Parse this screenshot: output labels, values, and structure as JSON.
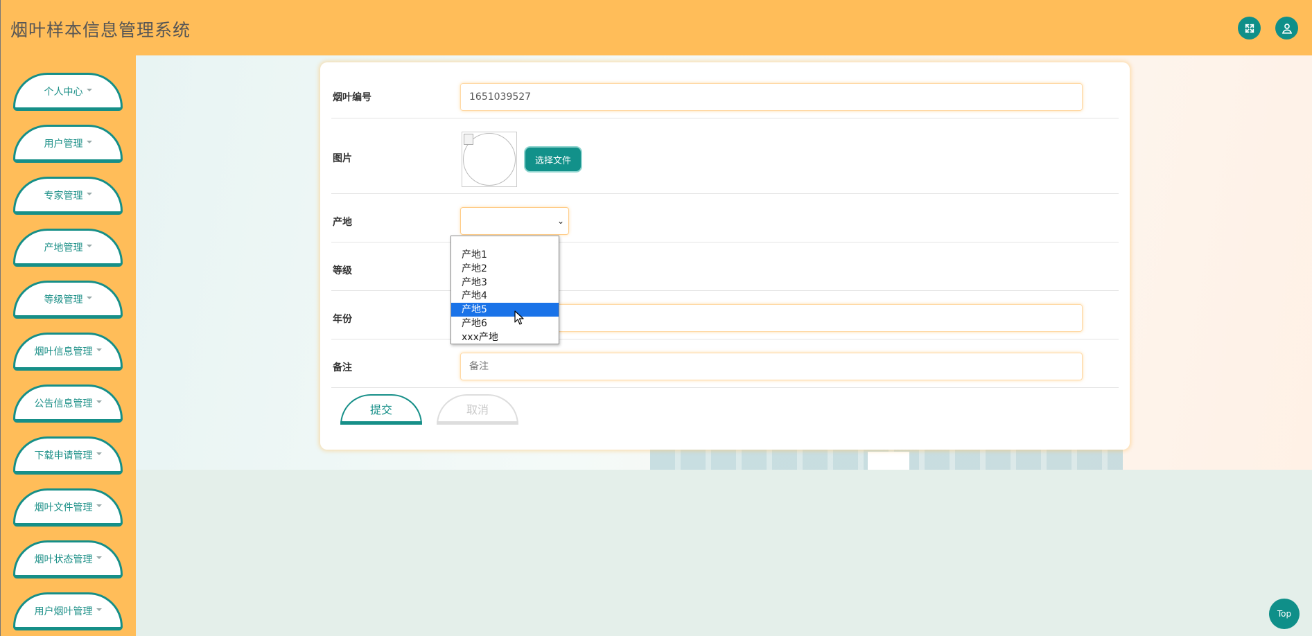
{
  "app": {
    "title": "烟叶样本信息管理系统"
  },
  "header": {
    "fullscreen_icon": "expand-arrows-icon",
    "user_icon": "user-icon"
  },
  "sidebar": {
    "items": [
      {
        "label": "个人中心"
      },
      {
        "label": "用户管理"
      },
      {
        "label": "专家管理"
      },
      {
        "label": "产地管理"
      },
      {
        "label": "等级管理"
      },
      {
        "label": "烟叶信息管理"
      },
      {
        "label": "公告信息管理"
      },
      {
        "label": "下载申请管理"
      },
      {
        "label": "烟叶文件管理"
      },
      {
        "label": "烟叶状态管理"
      },
      {
        "label": "用户烟叶管理"
      }
    ]
  },
  "form": {
    "code": {
      "label": "烟叶编号",
      "value": "1651039527"
    },
    "image": {
      "label": "图片",
      "button": "选择文件"
    },
    "origin": {
      "label": "产地",
      "value": "",
      "options": [
        "",
        "产地1",
        "产地2",
        "产地3",
        "产地4",
        "产地5",
        "产地6",
        "xxx产地"
      ],
      "highlighted": "产地5"
    },
    "grade": {
      "label": "等级"
    },
    "year": {
      "label": "年份",
      "value": ""
    },
    "remark": {
      "label": "备注",
      "placeholder": "备注"
    },
    "submit": "提交",
    "cancel": "取消"
  },
  "back_to_top": "Top",
  "colors": {
    "header_bg": "#ffbd59",
    "accent": "#0f8f89",
    "select_highlight": "#1a73e8"
  }
}
